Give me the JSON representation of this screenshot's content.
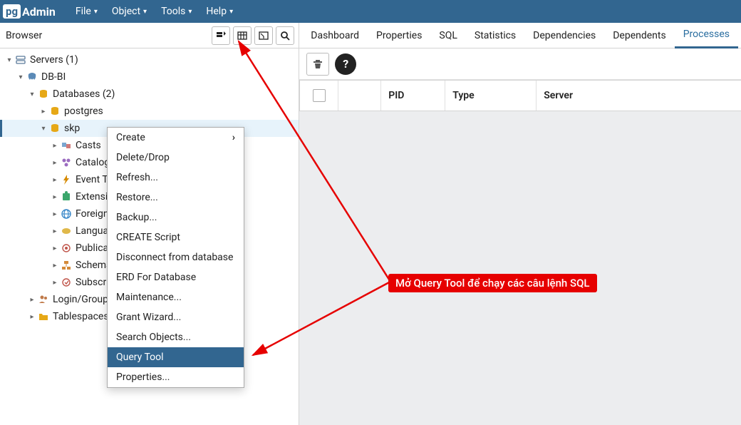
{
  "menubar": {
    "logo_box": "pg",
    "logo_text": "Admin",
    "items": [
      "File",
      "Object",
      "Tools",
      "Help"
    ]
  },
  "browser": {
    "title": "Browser"
  },
  "tree": {
    "servers": "Servers (1)",
    "db_bi": "DB-BI",
    "databases": "Databases (2)",
    "postgres": "postgres",
    "skp": "skp",
    "casts": "Casts",
    "catalogs": "Catalogs",
    "event_triggers": "Event Triggers",
    "extensions": "Extensions",
    "foreign": "Foreign Data Wrappers",
    "languages": "Languages",
    "publications": "Publications",
    "schemas": "Schemas",
    "subscriptions": "Subscriptions",
    "login_group": "Login/Group Roles",
    "tablespaces": "Tablespaces"
  },
  "tabs": [
    "Dashboard",
    "Properties",
    "SQL",
    "Statistics",
    "Dependencies",
    "Dependents",
    "Processes"
  ],
  "active_tab": 6,
  "table": {
    "cols": {
      "pid": "PID",
      "type": "Type",
      "server": "Server"
    }
  },
  "context_menu": [
    {
      "label": "Create",
      "submenu": true
    },
    {
      "label": "Delete/Drop"
    },
    {
      "label": "Refresh..."
    },
    {
      "label": "Restore..."
    },
    {
      "label": "Backup..."
    },
    {
      "label": "CREATE Script"
    },
    {
      "label": "Disconnect from database"
    },
    {
      "label": "ERD For Database"
    },
    {
      "label": "Maintenance..."
    },
    {
      "label": "Grant Wizard..."
    },
    {
      "label": "Search Objects..."
    },
    {
      "label": "Query Tool",
      "highlight": true
    },
    {
      "label": "Properties..."
    }
  ],
  "callout": "Mở Query Tool để chạy các câu lệnh SQL"
}
